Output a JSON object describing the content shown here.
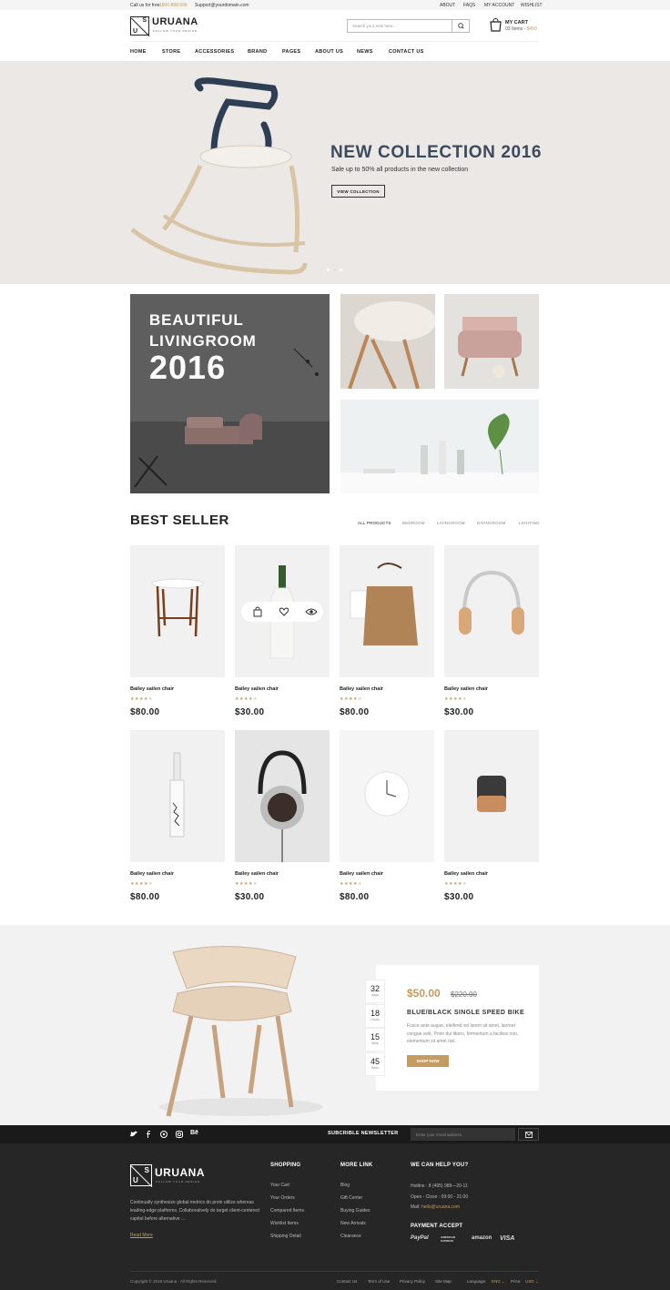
{
  "topbar": {
    "call_label": "Call us for free",
    "phone": "1800.888.999",
    "email": "Support@yourdomain.com",
    "links": [
      "ABOUT",
      "FAQS",
      "MY ACCOUNT",
      "WISHLIST"
    ]
  },
  "header": {
    "logo_text": "URUANA",
    "logo_tagline": "FOLLOW YOUR DESIGN",
    "logo_s": "S",
    "logo_u": "U",
    "search_placeholder": "Search your entri here...",
    "cart_title": "MY CART",
    "cart_items": "03 Items",
    "cart_total": "$450"
  },
  "nav": [
    "HOME",
    "STORE",
    "ACCESSORIES",
    "BRAND",
    "PAGES",
    "ABOUT US",
    "NEWS",
    "CONTACT US"
  ],
  "hero": {
    "title": "NEW COLLECTION 2016",
    "subtitle": "Sale up to 50% all products in the new collection",
    "button": "VIEW COLLECTION"
  },
  "collage": {
    "line1": "BEAUTIFUL",
    "line2": "LIVINGROOM",
    "line3": "2016"
  },
  "bestseller": {
    "title": "BEST SELLER",
    "tabs": [
      "ALL PRODUCTS",
      "BEDROOM",
      "LIVINGROOM",
      "DIVINGROOM",
      "LIGHTING"
    ],
    "products": [
      {
        "name": "Bailey sailen chair",
        "price": "$80.00",
        "rating": 4,
        "icon": "side-table"
      },
      {
        "name": "Bailey sailen chair",
        "price": "$30.00",
        "rating": 4,
        "icon": "wine-bottle"
      },
      {
        "name": "Bailey sailen chair",
        "price": "$80.00",
        "rating": 4,
        "icon": "tote-bag"
      },
      {
        "name": "Bailey sailen chair",
        "price": "$30.00",
        "rating": 4,
        "icon": "headphones"
      },
      {
        "name": "Bailey sailen chair",
        "price": "$80.00",
        "rating": 4,
        "icon": "glass-bottle"
      },
      {
        "name": "Bailey sailen chair",
        "price": "$30.00",
        "rating": 4,
        "icon": "studio-headphones"
      },
      {
        "name": "Bailey sailen chair",
        "price": "$80.00",
        "rating": 4,
        "icon": "wall-clock"
      },
      {
        "name": "Bailey sailen chair",
        "price": "$30.00",
        "rating": 4,
        "icon": "speaker"
      }
    ]
  },
  "deal": {
    "price": "$50.00",
    "old_price": "$220.00",
    "title": "BLUE/BLACK SINGLE SPEED BIKE",
    "desc": "Fusce ante augue, eleifend vel lorem sit amet, laoreet congue velit. Proin dui libero, fermentum a facilisis non, elementum sit amet nisl.",
    "button": "SHOP NOW",
    "countdown": [
      {
        "n": "32",
        "l": "days"
      },
      {
        "n": "18",
        "l": "Hours"
      },
      {
        "n": "15",
        "l": "Mins"
      },
      {
        "n": "45",
        "l": "Secs"
      }
    ]
  },
  "newsletter": {
    "title": "SUBCRIBLE NEWSLETTER",
    "placeholder": "Enter your email address"
  },
  "footer": {
    "about": "Continually synthesize global metrics do proin utilize whereas leading-edge platforms. Collaboratively do target client-centered capital before alternative ...",
    "read_more": "Read More",
    "shopping": {
      "title": "SHOPPING",
      "links": [
        "Your Cart",
        "Your Orders",
        "Compared Items",
        "Wishlist Items",
        "Shipping Detail"
      ]
    },
    "more": {
      "title": "MORE LINK",
      "links": [
        "Blog",
        "Gift Center",
        "Buying Guides",
        "New Arrivals",
        "Clearance"
      ]
    },
    "help": {
      "title": "WE CAN HELP YOU?",
      "hotline": "Hotline : 8 (495) 989—20-11",
      "open": "Open - Close : 09:00 - 21:00",
      "mail_label": "Mail:",
      "mail": "hello@uruana.com"
    },
    "payment": {
      "title": "PAYMENT ACCEPT",
      "methods": [
        "PayPal",
        "AMERICAN EXPRESS",
        "amazon",
        "VISA"
      ]
    },
    "copyright": "Copyright © 2016 Uruana - All Rights Reserved.",
    "bottom_links": [
      "Contact Us",
      "Term of Use",
      "Privacy Policy",
      "Site Map"
    ],
    "language_label": "Language:",
    "language": "ENG",
    "price_label": "Price:",
    "currency": "USD"
  }
}
